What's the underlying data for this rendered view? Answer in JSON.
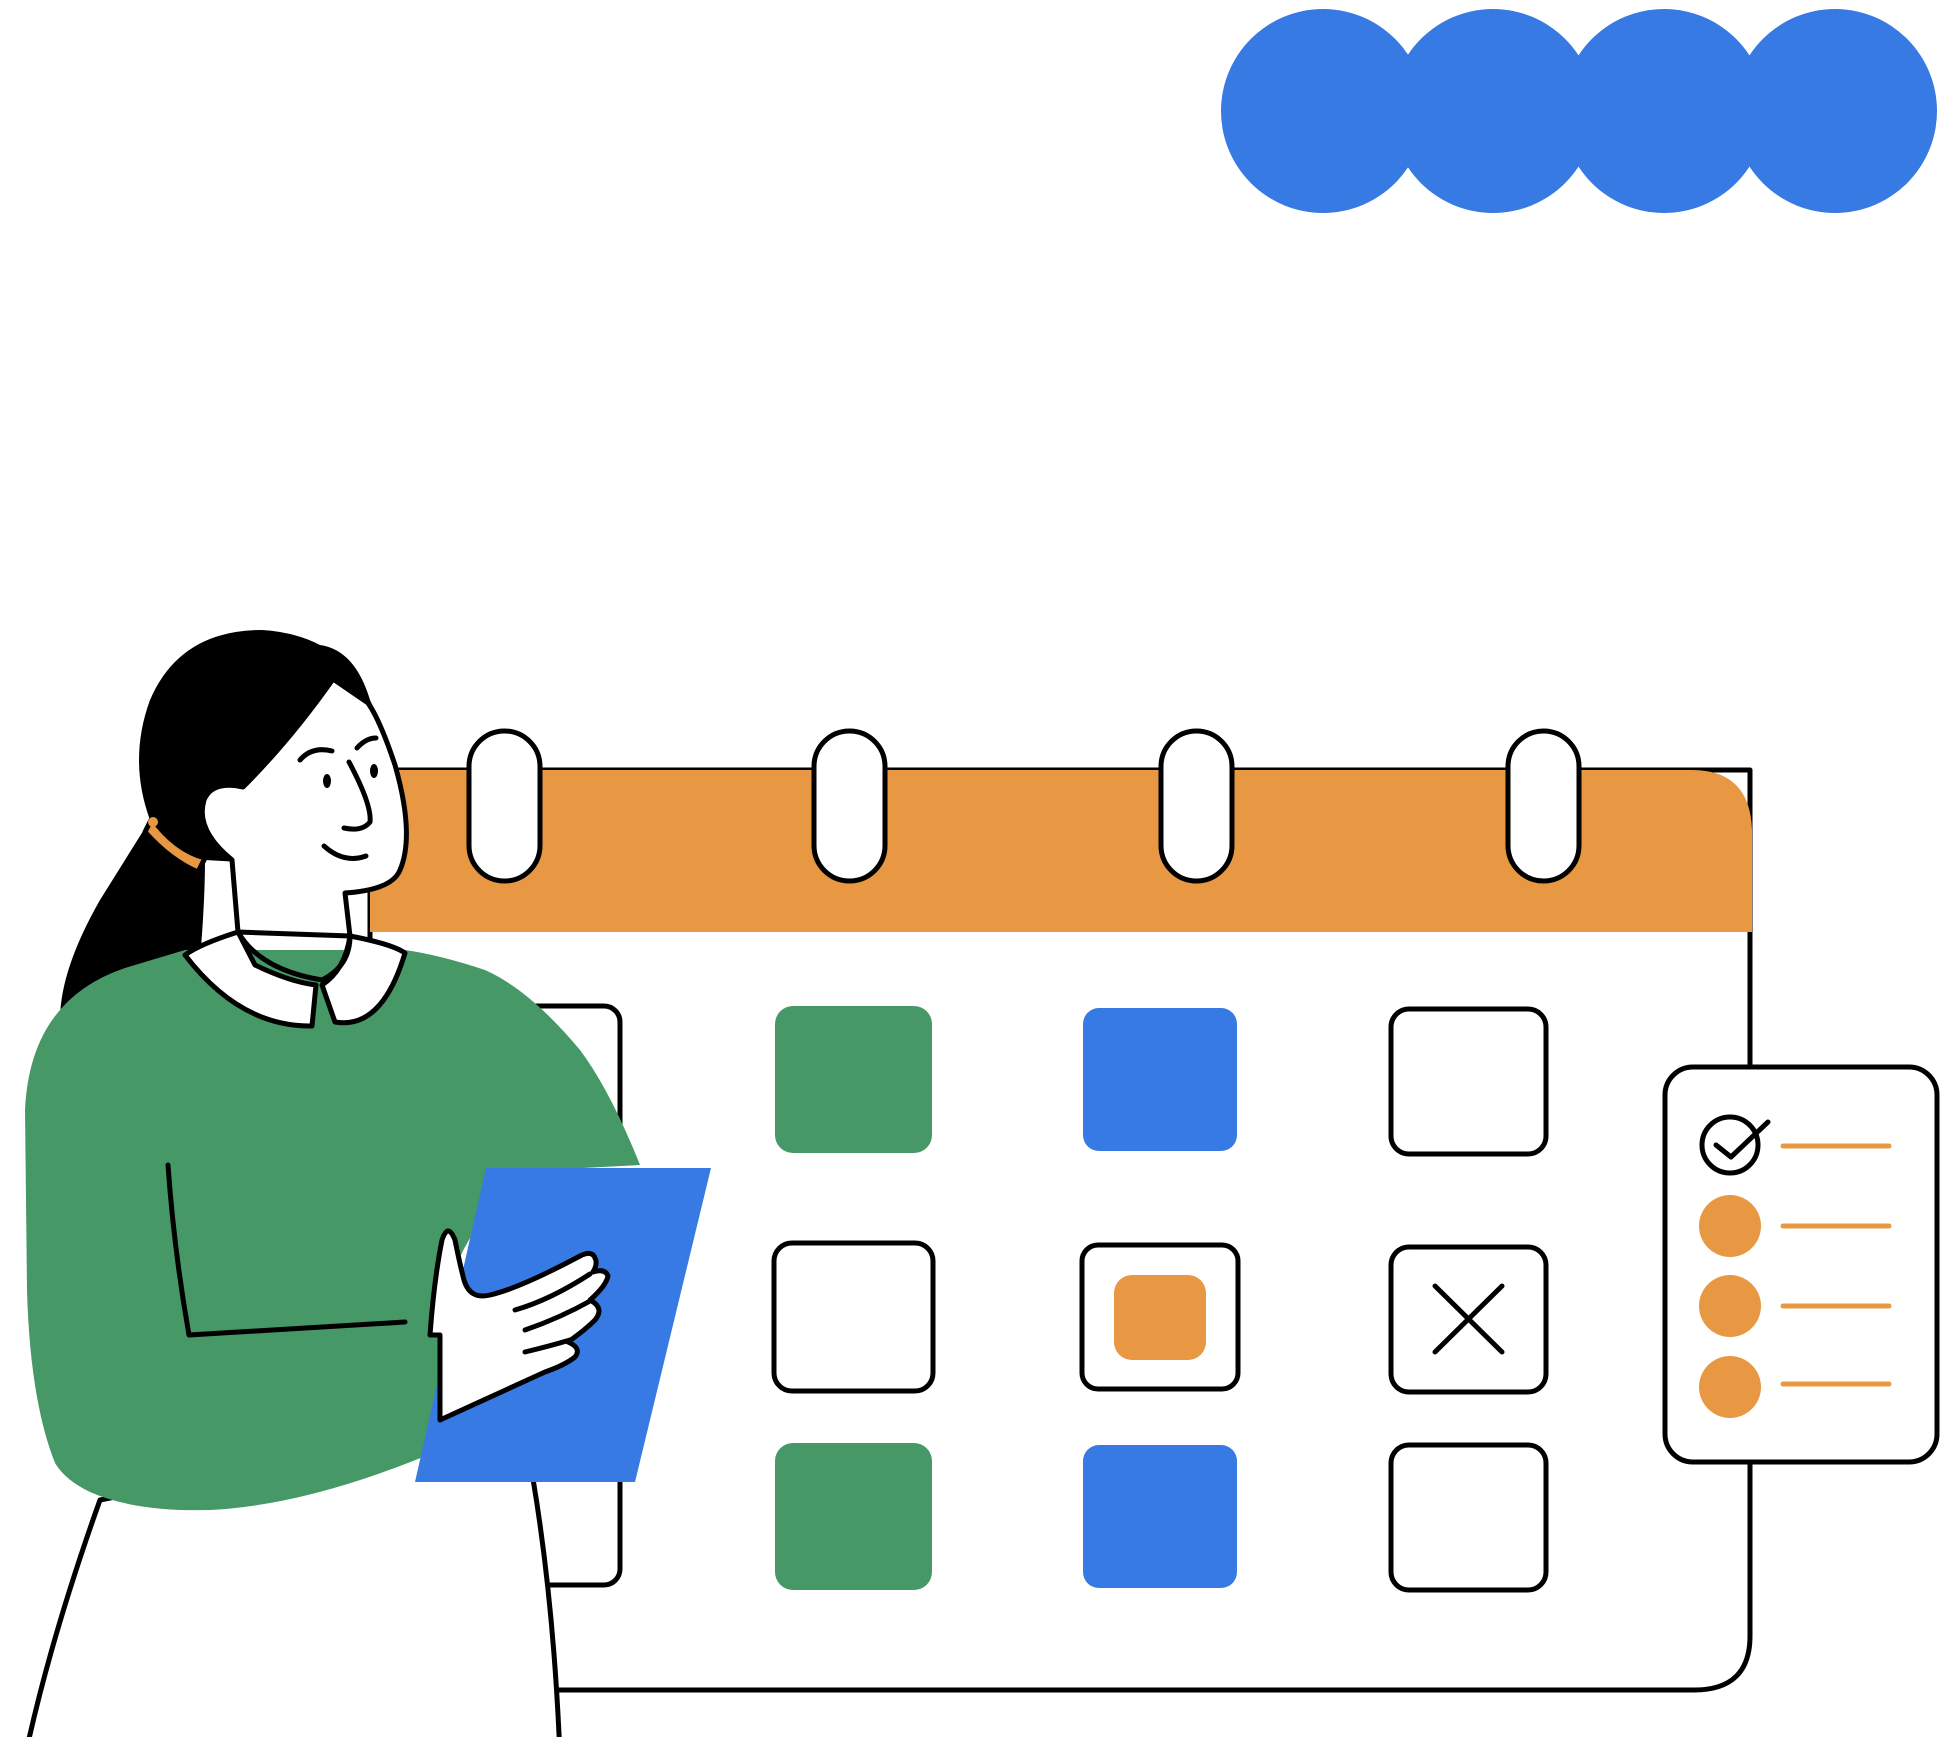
{
  "colors": {
    "blue": "#377ae3",
    "green": "#469966",
    "orange": "#e89842",
    "ink": "#000000",
    "paper": "#ffffff"
  },
  "decoration": {
    "dots_count": 4
  },
  "calendar": {
    "binder_rings": 4,
    "grid": [
      [
        "outline",
        "green",
        "blue",
        "outline"
      ],
      [
        "outline",
        "outline",
        "orange-inset",
        "crossed"
      ],
      [
        "outline",
        "green",
        "blue",
        "outline"
      ]
    ]
  },
  "checklist": {
    "items": [
      {
        "state": "checked"
      },
      {
        "state": "pending"
      },
      {
        "state": "pending"
      },
      {
        "state": "pending"
      }
    ]
  },
  "person": {
    "shirt": "green",
    "tablet": "blue",
    "earring": "orange"
  }
}
